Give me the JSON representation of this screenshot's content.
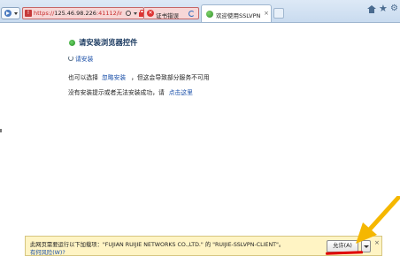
{
  "browser": {
    "address_prefix": "https://",
    "address_host": "125.46.98.226",
    "address_rest": ":41112/imanifest",
    "cert_error_label": "证书错误",
    "tab_title": "欢迎使用SSLVPN",
    "tab_close": "×"
  },
  "page": {
    "heading": "请安装浏览器控件",
    "install_link": "请安装",
    "alt_prefix": "也可以选择",
    "alt_link": "忽略安装",
    "alt_suffix": "，但这会导致部分服务不可用",
    "fail_text": "没有安装提示或者无法安装成功，请",
    "fail_link": "点击这里"
  },
  "notification": {
    "message": "此网页需要运行以下加载项：\"FUJIAN RUIJIE NETWORKS CO.,LTD.\" 的 \"RUIJIE-SSLVPN-CLIENT\"。",
    "risk_link": "有何风险(W)?",
    "allow_label": "允许(A)",
    "close": "×"
  },
  "colors": {
    "annotation_arrow": "#f5b700",
    "annotation_underline": "#e00000",
    "notification_bg": "#fff4c4",
    "link": "#1a4fa8"
  },
  "icons": [
    "arrow-icon",
    "dropdown-icon",
    "cert-icon",
    "search-icon",
    "lock-icon",
    "close-icon",
    "refresh-icon",
    "globe-icon",
    "home-icon",
    "star-icon",
    "gear-icon",
    "plugin-icon",
    "spinner-icon"
  ]
}
